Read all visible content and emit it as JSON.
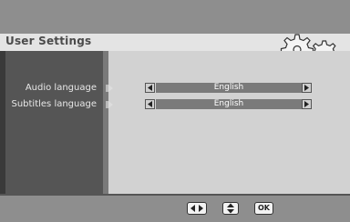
{
  "header": {
    "title": "User Settings"
  },
  "settings": [
    {
      "label": "Audio language",
      "value": "English"
    },
    {
      "label": "Subtitles language",
      "value": "English"
    }
  ],
  "footer": {
    "keys": [
      {
        "icon": "left-right-arrows-icon"
      },
      {
        "icon": "up-down-arrows-icon"
      },
      {
        "label": "OK"
      }
    ]
  },
  "icons": {
    "header_graphic": "gears-icon"
  },
  "colors": {
    "panel_dark": "#555555",
    "content_bg": "#d2d2d2",
    "selector_bar": "#7a7a7a",
    "frame_gray": "#8e8e8e"
  }
}
